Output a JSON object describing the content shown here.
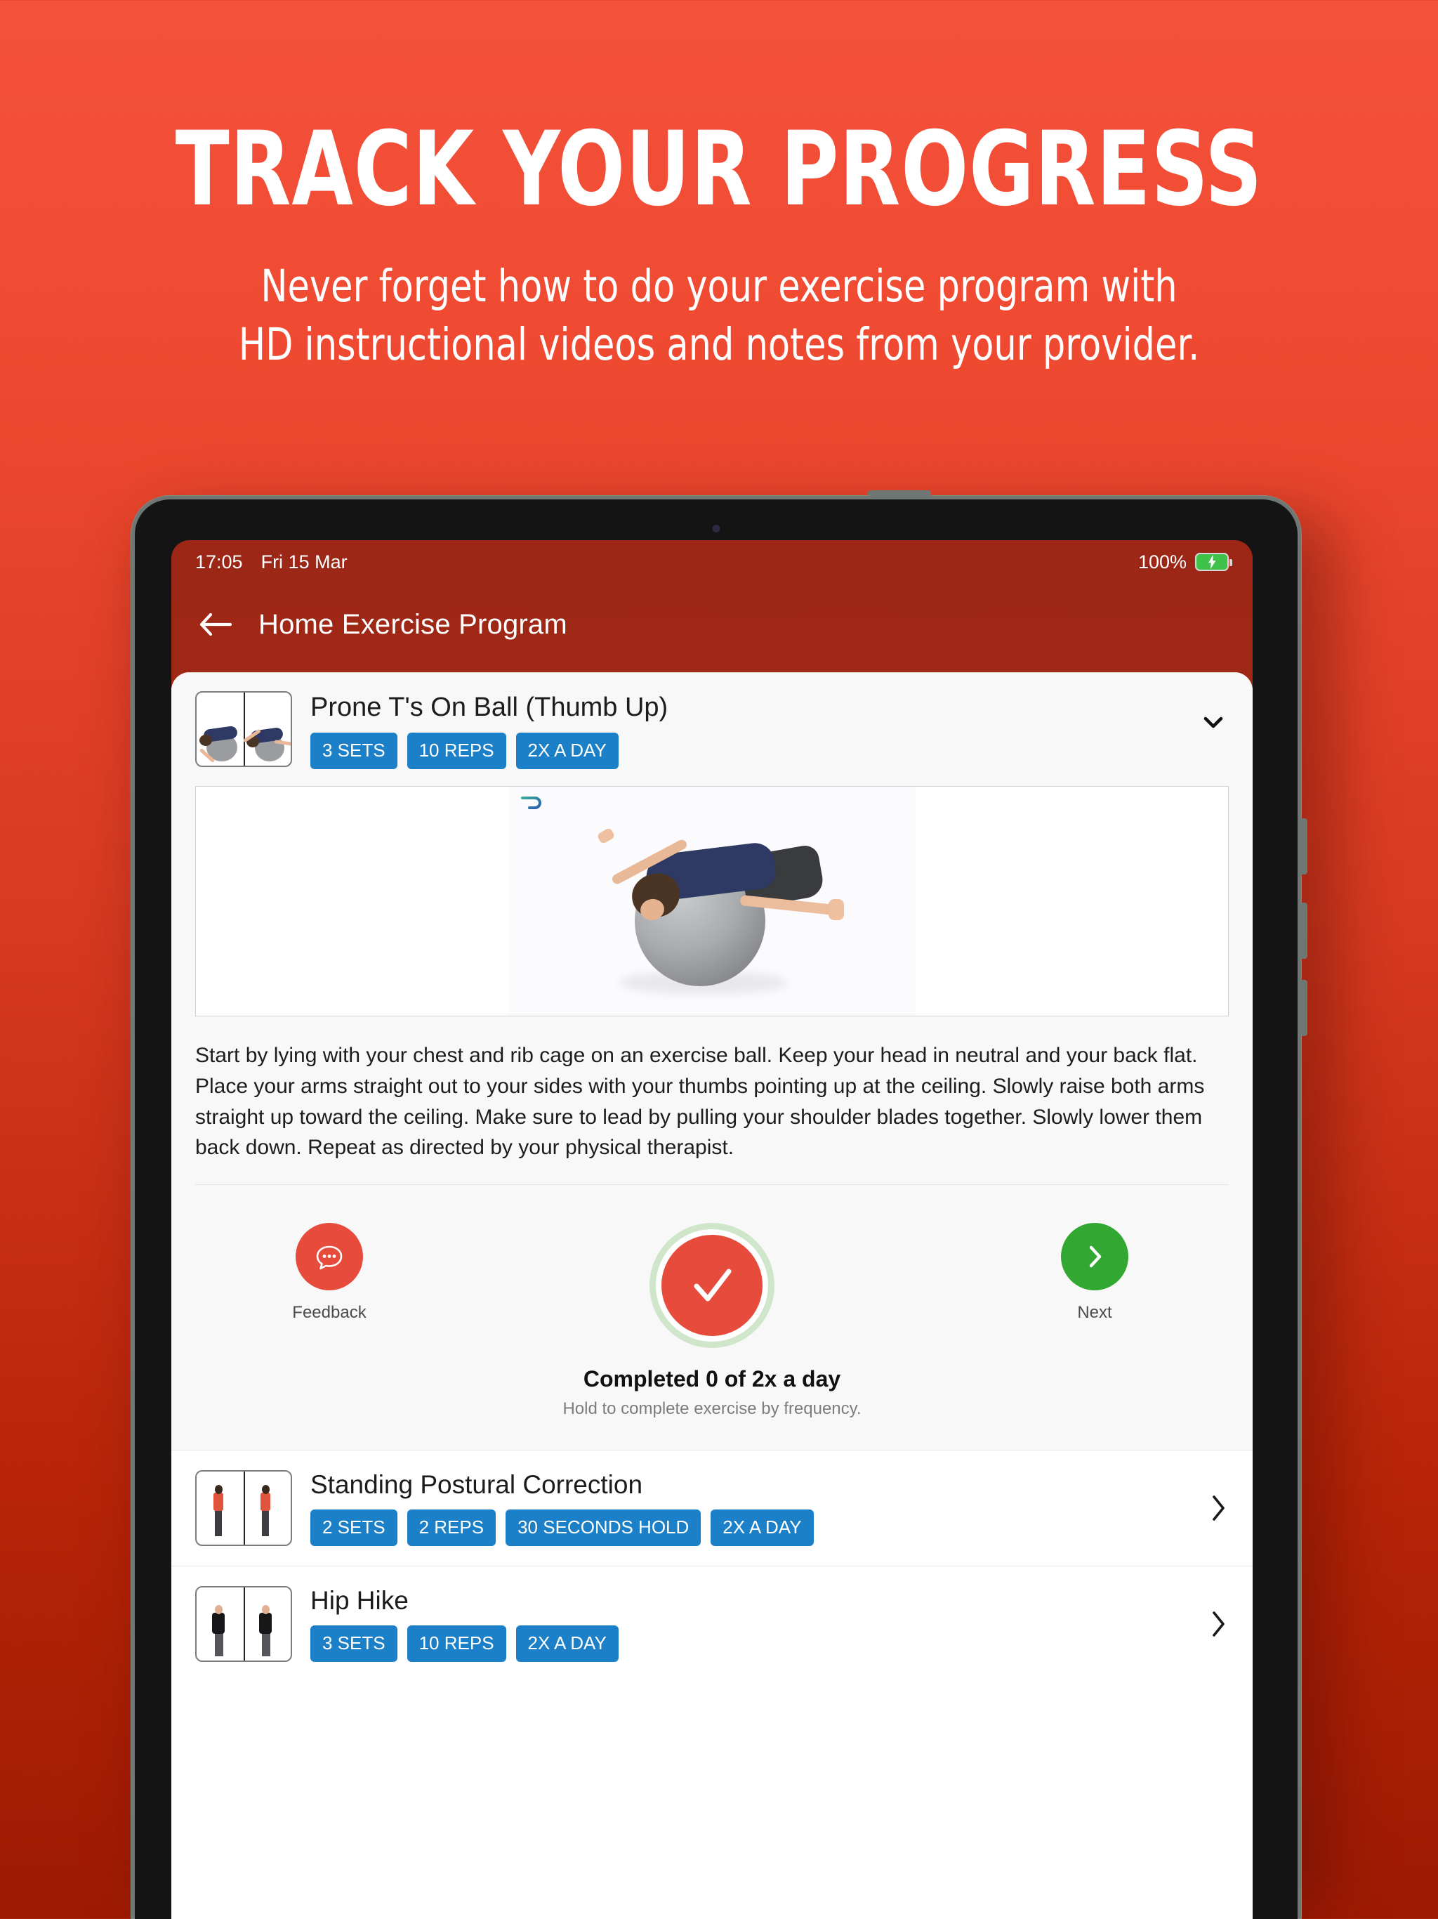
{
  "promo": {
    "title": "TRACK YOUR PROGRESS",
    "subtitle_line1": "Never forget how to do your exercise program with",
    "subtitle_line2": "HD instructional videos and notes from your provider."
  },
  "device": {
    "status_bar": {
      "time": "17:05",
      "date": "Fri 15 Mar",
      "battery_percent": "100%",
      "battery_icon": "battery-charging-icon",
      "battery_color": "#3fc24a"
    },
    "nav": {
      "back_icon": "arrow-left-icon",
      "title": "Home Exercise Program",
      "bar_color": "#a62817"
    }
  },
  "exercise_detail": {
    "thumbnail_icon": "exercise-thumbnail",
    "title": "Prone T's On Ball (Thumb Up)",
    "badges": [
      "3 SETS",
      "10 REPS",
      "2X A DAY"
    ],
    "badge_color": "#1b80c7",
    "expand_icon": "chevron-down-icon",
    "video": {
      "watermark_icon": "physitrack-p-logo",
      "watermark_color": "#2f9a9a",
      "content_alt": "prone-t-on-ball-video-frame"
    },
    "description": "Start by lying with your chest and rib cage on an exercise ball. Keep your head in neutral and your back flat. Place your arms straight out to your sides with your thumbs pointing up at the ceiling. Slowly raise both arms straight up toward the ceiling. Make sure to lead by pulling your shoulder blades together. Slowly lower them back down. Repeat as directed by your physical therapist.",
    "actions": {
      "feedback": {
        "label": "Feedback",
        "icon": "chat-bubble-icon",
        "color": "#e74b3c"
      },
      "complete": {
        "icon": "checkmark-icon",
        "color": "#e74b3c",
        "ring_color": "#cfe6cb"
      },
      "next": {
        "label": "Next",
        "icon": "chevron-right-icon",
        "color": "#32a832"
      }
    },
    "status_main": "Completed 0 of 2x a day",
    "status_sub": "Hold to complete exercise by frequency."
  },
  "exercise_list": [
    {
      "thumbnail_icon": "exercise-thumbnail",
      "title": "Standing Postural Correction",
      "badges": [
        "2 SETS",
        "2 REPS",
        "30 SECONDS HOLD",
        "2X A DAY"
      ],
      "chevron_icon": "chevron-right-icon"
    },
    {
      "thumbnail_icon": "exercise-thumbnail",
      "title": "Hip Hike",
      "badges": [
        "3 SETS",
        "10 REPS",
        "2X A DAY"
      ],
      "chevron_icon": "chevron-right-icon"
    }
  ],
  "theme": {
    "background_top": "#f5523c",
    "background_bottom": "#9d1a04",
    "app_red": "#a62817",
    "badge_blue": "#1b80c7"
  }
}
